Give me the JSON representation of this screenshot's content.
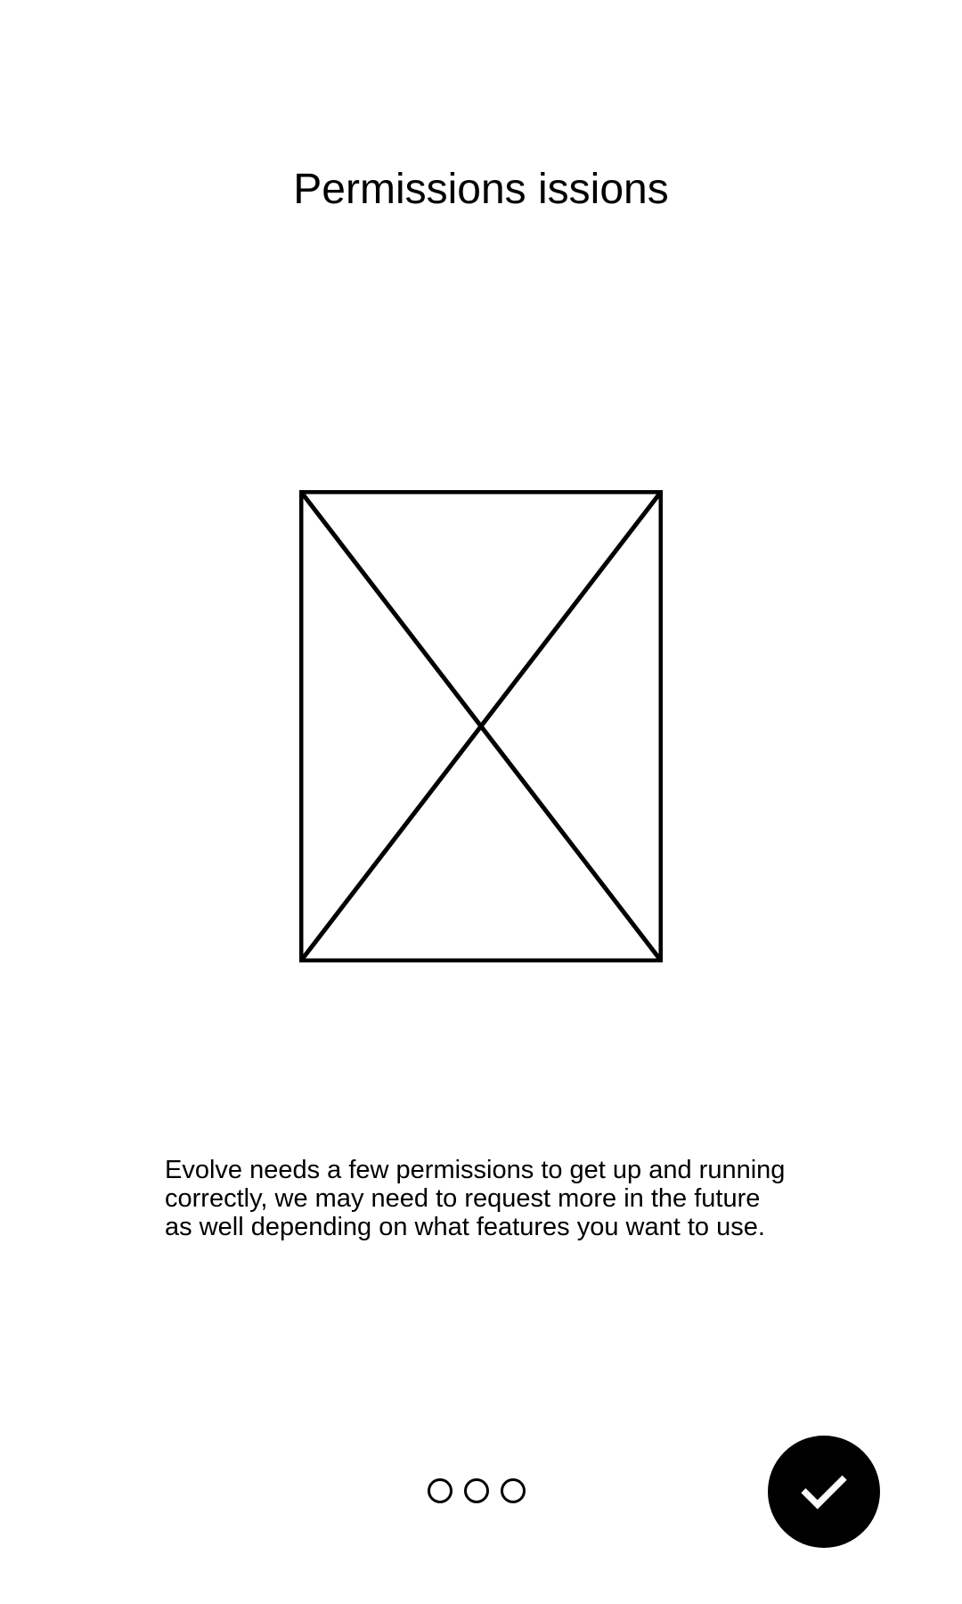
{
  "screen": {
    "title": "Permissions issions",
    "description": "Evolve needs a few permissions to get up and running correctly, we may need to request more in the future as well depending on what features you want to use."
  },
  "pager": {
    "page_count": 3
  },
  "fab": {
    "icon": "check-icon"
  },
  "colors": {
    "background": "#ffffff",
    "foreground": "#000000"
  }
}
